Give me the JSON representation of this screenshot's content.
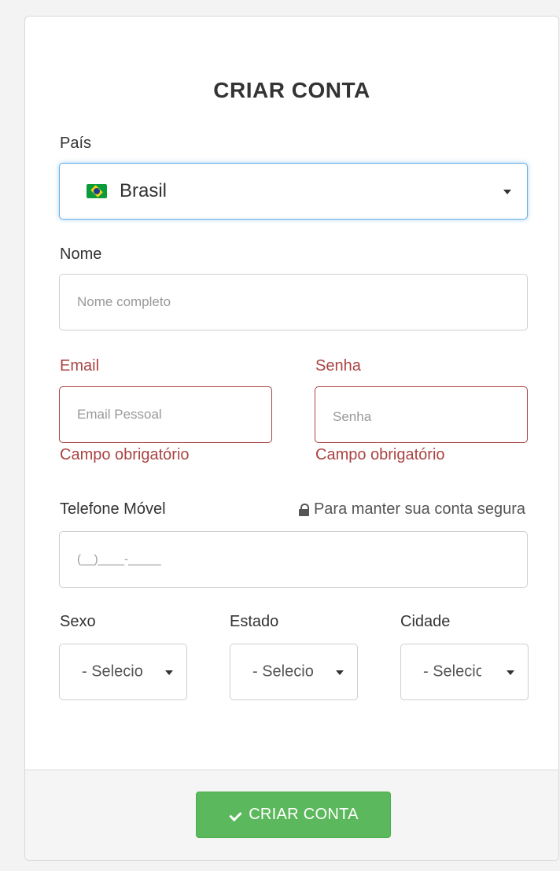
{
  "form": {
    "title": "CRIAR CONTA",
    "country": {
      "label": "País",
      "value": "Brasil",
      "flag_icon": "brazil-flag-icon"
    },
    "name": {
      "label": "Nome",
      "placeholder": "Nome completo"
    },
    "email": {
      "label": "Email",
      "placeholder": "Email Pessoal",
      "error": "Campo obrigatório"
    },
    "password": {
      "label": "Senha",
      "placeholder": "Senha",
      "error": "Campo obrigatório"
    },
    "phone": {
      "label": "Telefone Móvel",
      "secure_note": "Para manter sua conta segura",
      "placeholder": "(__)____-_____"
    },
    "sex": {
      "label": "Sexo",
      "selected": "- Selecione -"
    },
    "state": {
      "label": "Estado",
      "selected": "- Selecione -"
    },
    "city": {
      "label": "Cidade",
      "selected": "- Selecione -"
    },
    "submit_label": "CRIAR CONTA"
  },
  "colors": {
    "error": "#a94442",
    "focus": "#66afe9",
    "primary_button": "#5cb85c"
  }
}
